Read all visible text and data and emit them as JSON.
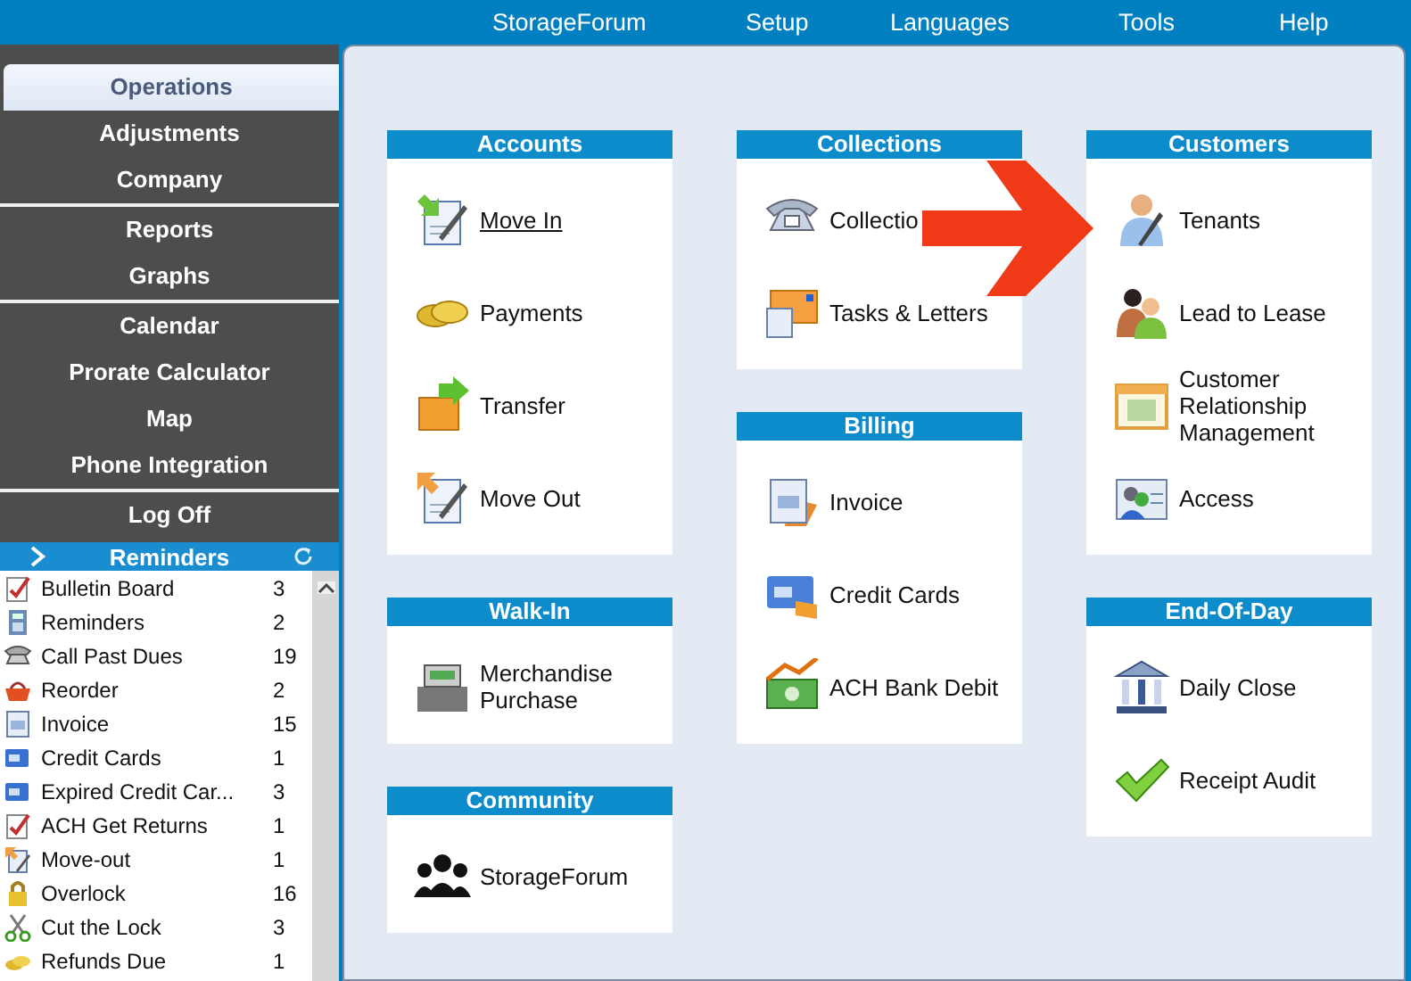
{
  "menu_bar": {
    "items": [
      "StorageForum",
      "Setup",
      "Languages",
      "Tools",
      "Help"
    ]
  },
  "sidebar": {
    "groups": [
      [
        {
          "label": "Operations",
          "selected": true
        },
        {
          "label": "Adjustments",
          "selected": false
        },
        {
          "label": "Company",
          "selected": false
        }
      ],
      [
        {
          "label": "Reports",
          "selected": false
        },
        {
          "label": "Graphs",
          "selected": false
        }
      ],
      [
        {
          "label": "Calendar",
          "selected": false
        },
        {
          "label": "Prorate Calculator",
          "selected": false
        },
        {
          "label": "Map",
          "selected": false
        },
        {
          "label": "Phone Integration",
          "selected": false
        }
      ],
      [
        {
          "label": "Log Off",
          "selected": false
        }
      ]
    ]
  },
  "reminders": {
    "title": "Reminders",
    "items": [
      {
        "label": "Bulletin Board",
        "count": "3"
      },
      {
        "label": "Reminders",
        "count": "2"
      },
      {
        "label": "Call Past Dues",
        "count": "19"
      },
      {
        "label": "Reorder",
        "count": "2"
      },
      {
        "label": "Invoice",
        "count": "15"
      },
      {
        "label": "Credit Cards",
        "count": "1"
      },
      {
        "label": "Expired Credit Car...",
        "count": "3"
      },
      {
        "label": "ACH Get Returns",
        "count": "1"
      },
      {
        "label": "Move-out",
        "count": "1"
      },
      {
        "label": "Overlock",
        "count": "16"
      },
      {
        "label": "Cut the Lock",
        "count": "3"
      },
      {
        "label": "Refunds Due",
        "count": "1"
      }
    ]
  },
  "columns": [
    {
      "cards": [
        {
          "title": "Accounts",
          "items": [
            {
              "label": "Move In",
              "hovered": true
            },
            {
              "label": "Payments",
              "hovered": false
            },
            {
              "label": "Transfer",
              "hovered": false
            },
            {
              "label": "Move Out",
              "hovered": false
            }
          ]
        },
        {
          "title": "Walk-In",
          "items": [
            {
              "label": "Merchandise Purchase",
              "hovered": false
            }
          ]
        },
        {
          "title": "Community",
          "items": [
            {
              "label": "StorageForum",
              "hovered": false
            }
          ]
        }
      ]
    },
    {
      "cards": [
        {
          "title": "Collections",
          "items": [
            {
              "label": "Collectio",
              "hovered": false
            },
            {
              "label": "Tasks & Letters",
              "hovered": false
            }
          ]
        },
        {
          "title": "Billing",
          "items": [
            {
              "label": "Invoice",
              "hovered": false
            },
            {
              "label": "Credit Cards",
              "hovered": false
            },
            {
              "label": "ACH Bank Debit",
              "hovered": false
            }
          ]
        }
      ]
    },
    {
      "cards": [
        {
          "title": "Customers",
          "items": [
            {
              "label": "Tenants",
              "hovered": false
            },
            {
              "label": "Lead to Lease",
              "hovered": false
            },
            {
              "label": "Customer Relationship Management",
              "hovered": false
            },
            {
              "label": "Access",
              "hovered": false
            }
          ]
        },
        {
          "title": "End-Of-Day",
          "items": [
            {
              "label": "Daily Close",
              "hovered": false
            },
            {
              "label": "Receipt Audit",
              "hovered": false
            }
          ]
        }
      ]
    }
  ]
}
